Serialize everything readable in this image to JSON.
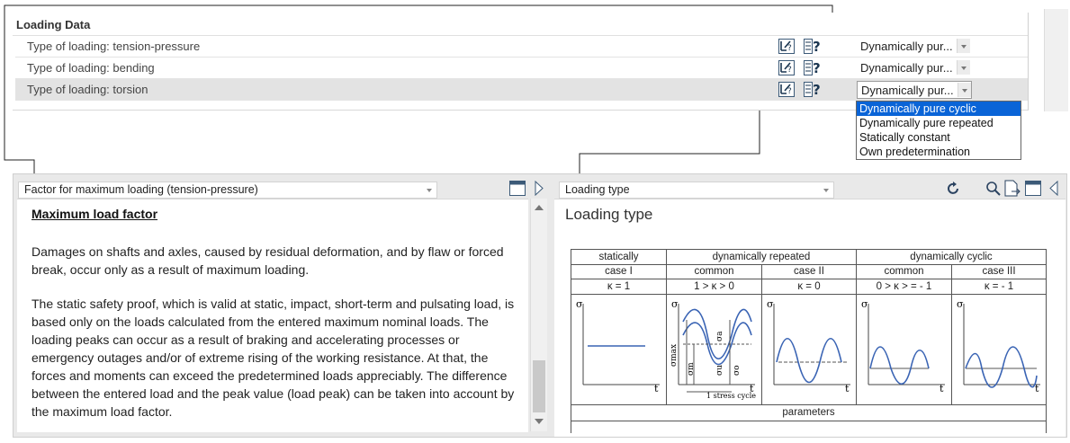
{
  "top_table": {
    "header": "Loading Data",
    "rows": [
      {
        "label": "Type of loading: tension-pressure",
        "value": "Dynamically pur..."
      },
      {
        "label": "Type of loading: bending",
        "value": "Dynamically pur..."
      },
      {
        "label": "Type of loading: torsion",
        "value": "Dynamically pur..."
      }
    ]
  },
  "dropdown": {
    "options": [
      "Dynamically pure cyclic",
      "Dynamically pure repeated",
      "Statically constant",
      "Own predetermination"
    ]
  },
  "left_panel": {
    "selector": "Factor for maximum loading (tension-pressure)",
    "heading": "Maximum load factor",
    "para1": "Damages on shafts and axles, caused by residual deformation, and by flaw or forced break, occur only as a result of maximum loading.",
    "para2": "The static safety proof, which is valid at static, impact, short-term and pulsating load, is based only on the loads calculated from the entered maximum nominal loads. The loading peaks can occur as a result of braking and accelerating processes or emergency outages and/or of extreme rising of the working resistance. At that, the forces and moments can exceed the predetermined loads appreciably. The difference between the entered load and the peak value (load peak) can be taken into account by the maximum load factor."
  },
  "right_panel": {
    "selector": "Loading type",
    "title": "Loading type",
    "diagram": {
      "groups": [
        "statically",
        "dynamically repeated",
        "dynamically cyclic"
      ],
      "sub": [
        "case I",
        "common",
        "case II",
        "common",
        "case III"
      ],
      "kappa": [
        "κ = 1",
        "1 > κ > 0",
        "κ = 0",
        "0 > κ > = - 1",
        "κ = - 1"
      ],
      "axis_y": "σ",
      "axis_x": "t",
      "sigma_max": "σmax",
      "sigma_m": "σm",
      "sigma_a": "σa",
      "sigma_u": "σu",
      "sigma_o": "σo",
      "stress_cycle": "1 stress cycle",
      "footer": "parameters"
    }
  },
  "colors": {
    "selection": "#0a64d7",
    "curve": "#3a64b4"
  }
}
